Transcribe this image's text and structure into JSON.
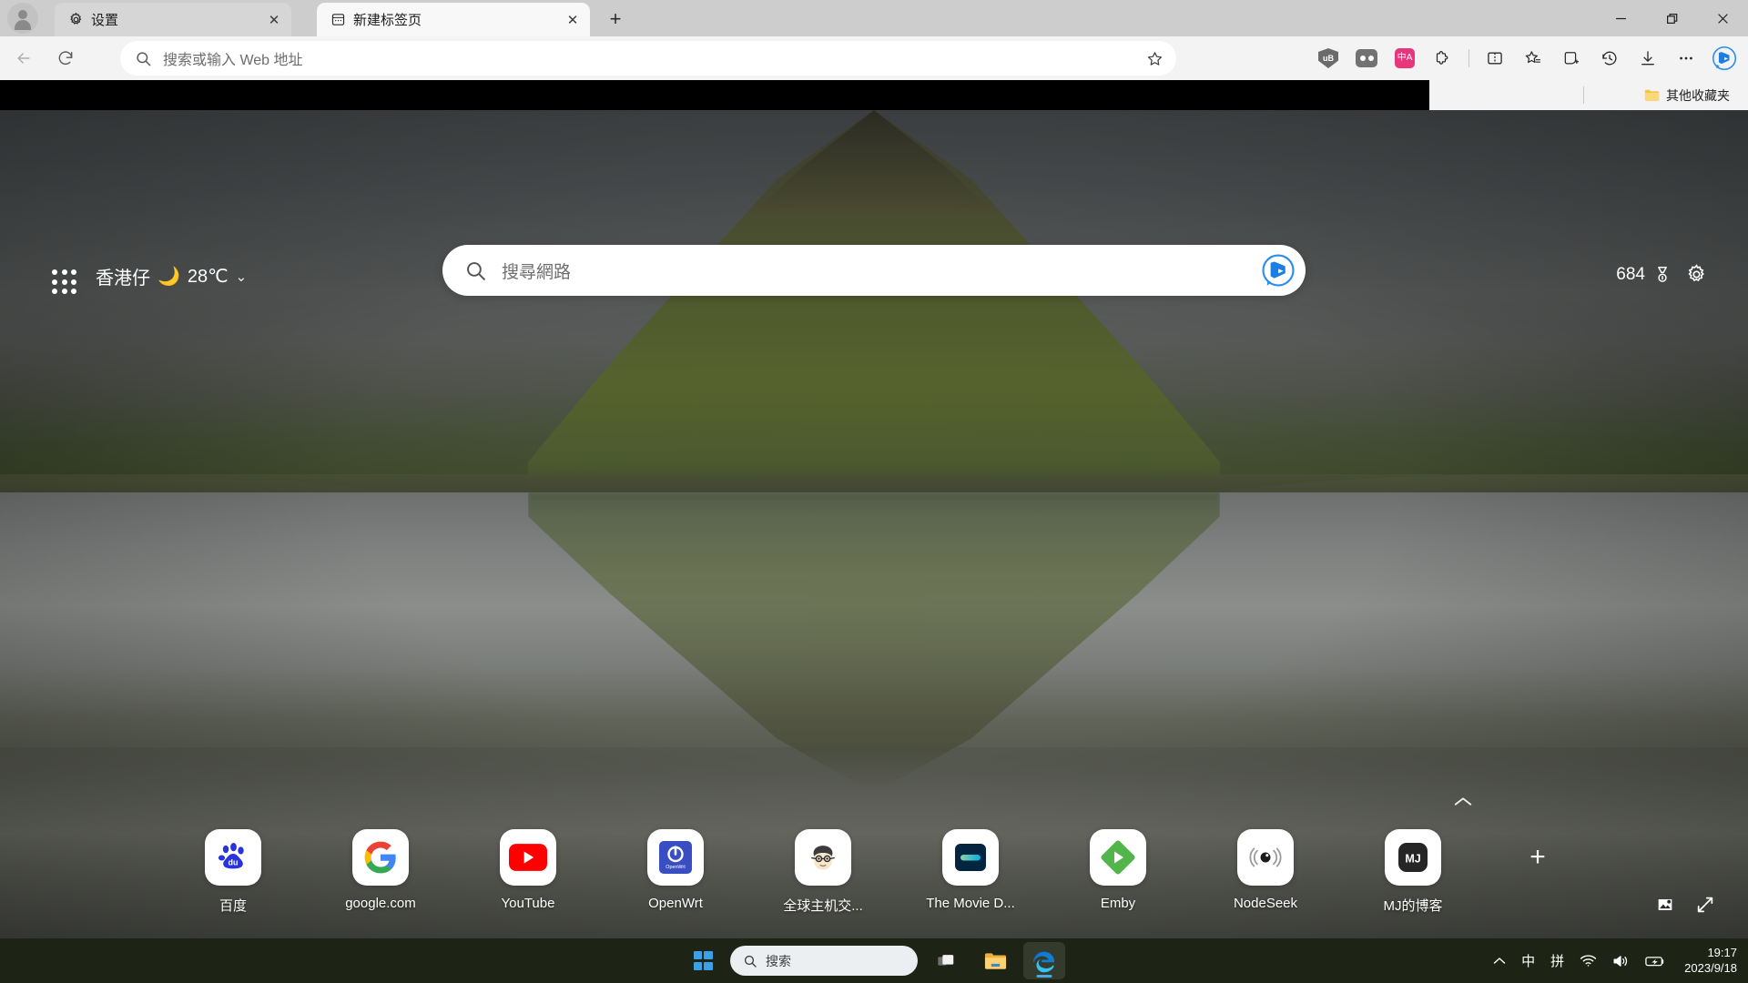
{
  "browser": {
    "profile_icon": "account-avatar",
    "tabs": [
      {
        "title": "设置",
        "icon": "gear-icon",
        "active": false
      },
      {
        "title": "新建标签页",
        "icon": "newtab-page-icon",
        "active": true
      }
    ],
    "new_tab_button": "+",
    "window_controls": {
      "minimize": "—",
      "restore": "❐",
      "close": "✕"
    },
    "nav": {
      "back": "back-arrow",
      "reload": "reload-icon"
    },
    "omnibox": {
      "placeholder": "搜索或输入 Web 地址",
      "value": "",
      "search_icon": "search-icon",
      "favorite_icon": "star-icon"
    },
    "toolbar_buttons": [
      {
        "name": "ublock-origin-extension",
        "label": "uB"
      },
      {
        "name": "extension-grey",
        "label": ""
      },
      {
        "name": "translate-extension",
        "label": "中A"
      },
      {
        "name": "extensions-puzzle-icon",
        "label": ""
      },
      {
        "name": "split-screen-icon",
        "label": ""
      },
      {
        "name": "favorites-icon",
        "label": ""
      },
      {
        "name": "collections-icon",
        "label": ""
      },
      {
        "name": "history-icon",
        "label": ""
      },
      {
        "name": "downloads-icon",
        "label": ""
      },
      {
        "name": "settings-and-more-icon",
        "label": "⋯"
      },
      {
        "name": "copilot-bing-icon",
        "label": ""
      }
    ],
    "bookmarks_bar": {
      "other_favorites_label": "其他收藏夹",
      "folder_icon": "folder-icon"
    }
  },
  "newtab": {
    "apps_grid_icon": "apps-grid-icon",
    "weather": {
      "city": "香港仔",
      "icon": "moon-cloud-icon",
      "temperature": "28℃",
      "chevron": "⌄"
    },
    "rewards": {
      "points": "684",
      "icon": "rewards-medal-icon"
    },
    "settings_icon": "gear-icon",
    "search": {
      "placeholder": "搜尋網路",
      "value": "",
      "search_icon": "search-icon",
      "copilot_icon": "bing-copilot-icon"
    },
    "collapse_icon": "chevron-up-icon",
    "add_shortcut_label": "+",
    "tiles": [
      {
        "label": "百度",
        "icon": "baidu-icon",
        "color": "#2932e1"
      },
      {
        "label": "google.com",
        "icon": "google-icon",
        "color": "#4285f4"
      },
      {
        "label": "YouTube",
        "icon": "youtube-icon",
        "color": "#ff0000"
      },
      {
        "label": "OpenWrt",
        "icon": "openwrt-icon",
        "color": "#3a4ec4"
      },
      {
        "label": "全球主机交...",
        "icon": "hostloc-icon",
        "color": "#f1e3c8"
      },
      {
        "label": "The Movie D...",
        "icon": "tmdb-icon",
        "color": "#032541"
      },
      {
        "label": "Emby",
        "icon": "emby-icon",
        "color": "#52b54b"
      },
      {
        "label": "NodeSeek",
        "icon": "nodeseek-icon",
        "color": "#1c1c1c"
      },
      {
        "label": "MJ的博客",
        "icon": "mj-blog-icon",
        "color": "#262626"
      }
    ],
    "image_info_icon": "image-info-icon",
    "fullscreen_icon": "expand-icon"
  },
  "taskbar": {
    "start_label": "start-button",
    "search": {
      "placeholder": "搜索",
      "value": "",
      "icon": "search-icon"
    },
    "apps": [
      {
        "name": "task-view",
        "active": false
      },
      {
        "name": "file-explorer",
        "active": false
      },
      {
        "name": "microsoft-edge",
        "active": true
      }
    ],
    "tray": {
      "overflow": "⌃",
      "ime_mode": "中",
      "ime_pinyin": "拼",
      "network": "wifi-icon",
      "volume": "volume-icon",
      "battery": "battery-icon",
      "time": "19:17",
      "date": "2023/9/18"
    }
  },
  "colors": {
    "accent_blue": "#0f6cbd",
    "edge_blue": "#3aa0e8",
    "taskbar_bg": "#1d2415",
    "chrome_bg": "#cdcdcd",
    "navbar_bg": "#f3f3f3"
  }
}
